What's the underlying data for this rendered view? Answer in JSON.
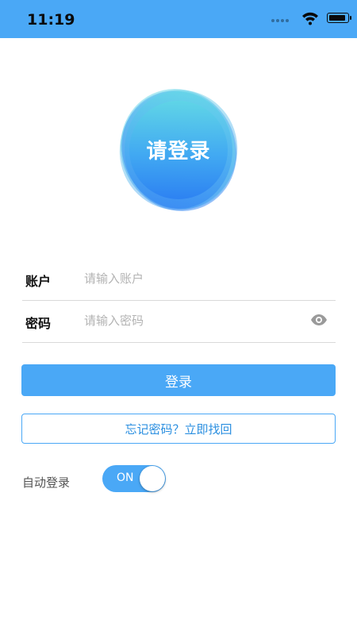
{
  "status_bar": {
    "time": "11:19",
    "battery_level": 0.9
  },
  "logo": {
    "text": "请登录"
  },
  "form": {
    "account_label": "账户",
    "account_placeholder": "请输入账户",
    "account_value": "",
    "password_label": "密码",
    "password_placeholder": "请输入密码",
    "password_value": ""
  },
  "actions": {
    "login_label": "登录",
    "forgot_label": "忘记密码？立即找回"
  },
  "auto_login": {
    "label": "自动登录",
    "toggle_text": "ON",
    "enabled": true
  },
  "colors": {
    "accent": "#4aa8f6",
    "accent_text": "#2b8fe0"
  }
}
